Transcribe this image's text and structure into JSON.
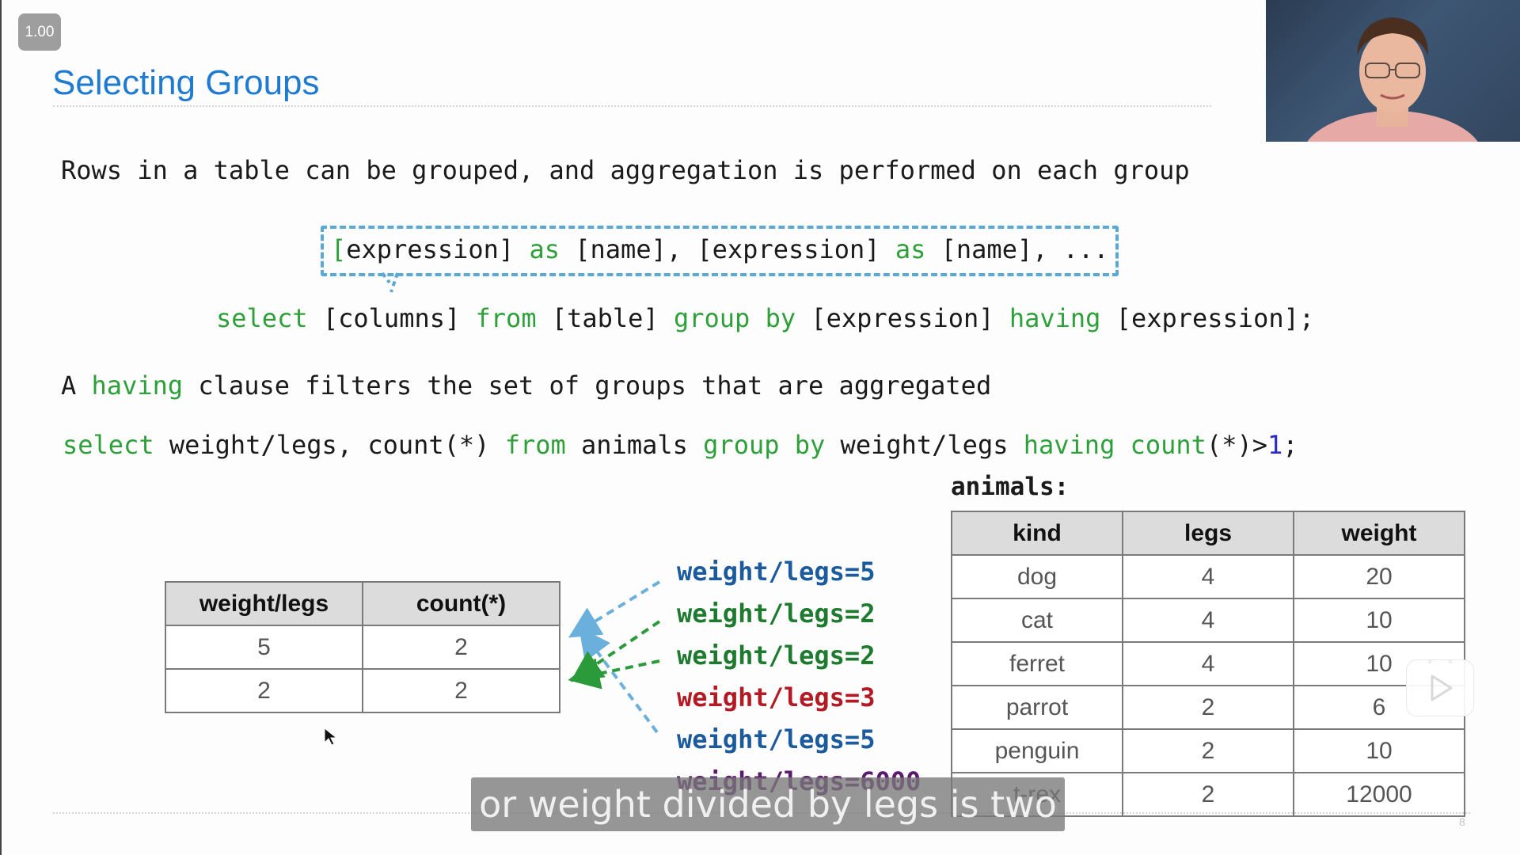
{
  "player": {
    "speed_label": "1.00",
    "subtitle": "or weight divided by legs is two",
    "page_number": "8",
    "webcam": "presenter-video"
  },
  "slide": {
    "title": "Selecting Groups",
    "intro": "Rows in a table can be grouped, and aggregation is performed on each group",
    "syntax_columns": [
      {
        "text": "[",
        "style": "kw"
      },
      {
        "text": "expression] ",
        "style": "plain"
      },
      {
        "text": "as",
        "style": "kw"
      },
      {
        "text": " [name], [expression] ",
        "style": "plain"
      },
      {
        "text": "as",
        "style": "kw"
      },
      {
        "text": " [name], ...",
        "style": "plain"
      }
    ],
    "syntax_select": [
      {
        "text": "select",
        "style": "kw"
      },
      {
        "text": " [columns] ",
        "style": "plain"
      },
      {
        "text": "from",
        "style": "kw"
      },
      {
        "text": " [table] ",
        "style": "plain"
      },
      {
        "text": "group by",
        "style": "kw"
      },
      {
        "text": " [expression] ",
        "style": "plain"
      },
      {
        "text": "having",
        "style": "kw"
      },
      {
        "text": " [expression];",
        "style": "plain"
      }
    ],
    "having_desc": [
      {
        "text": "A ",
        "style": "plain"
      },
      {
        "text": "having",
        "style": "kw"
      },
      {
        "text": " clause filters the set of groups that are aggregated",
        "style": "plain"
      }
    ],
    "example_query": [
      {
        "text": "select",
        "style": "kw"
      },
      {
        "text": " weight/legs, count(*) ",
        "style": "plain"
      },
      {
        "text": "from",
        "style": "kw"
      },
      {
        "text": " animals ",
        "style": "plain"
      },
      {
        "text": "group by",
        "style": "kw"
      },
      {
        "text": " weight/legs ",
        "style": "plain"
      },
      {
        "text": "having",
        "style": "kw"
      },
      {
        "text": " ",
        "style": "plain"
      },
      {
        "text": "count",
        "style": "kw"
      },
      {
        "text": "(*)>",
        "style": "plain"
      },
      {
        "text": "1",
        "style": "num"
      },
      {
        "text": ";",
        "style": "plain"
      }
    ],
    "result_table": {
      "headers": [
        "weight/legs",
        "count(*)"
      ],
      "rows": [
        [
          "5",
          "2"
        ],
        [
          "2",
          "2"
        ]
      ]
    },
    "groups": [
      {
        "label": "weight/legs=5",
        "color": "#1c5a9e"
      },
      {
        "label": "weight/legs=2",
        "color": "#1e7a2e"
      },
      {
        "label": "weight/legs=2",
        "color": "#1e7a2e"
      },
      {
        "label": "weight/legs=3",
        "color": "#b21a24"
      },
      {
        "label": "weight/legs=5",
        "color": "#1c5a9e"
      },
      {
        "label": "weight/legs=6000",
        "color": "#5a1b6e"
      }
    ],
    "animals_label": "animals:",
    "animals_table": {
      "headers": [
        "kind",
        "legs",
        "weight"
      ],
      "rows": [
        [
          "dog",
          "4",
          "20"
        ],
        [
          "cat",
          "4",
          "10"
        ],
        [
          "ferret",
          "4",
          "10"
        ],
        [
          "parrot",
          "2",
          "6"
        ],
        [
          "penguin",
          "2",
          "10"
        ],
        [
          "t-rex",
          "2",
          "12000"
        ]
      ]
    },
    "colors": {
      "title": "#1f7ad1",
      "keyword": "#2ea03a",
      "number": "#2a2ac8",
      "callout_dash": "#5aa8d6",
      "arrow_blue": "#6bb0dd",
      "arrow_green": "#2b9a3a"
    }
  }
}
